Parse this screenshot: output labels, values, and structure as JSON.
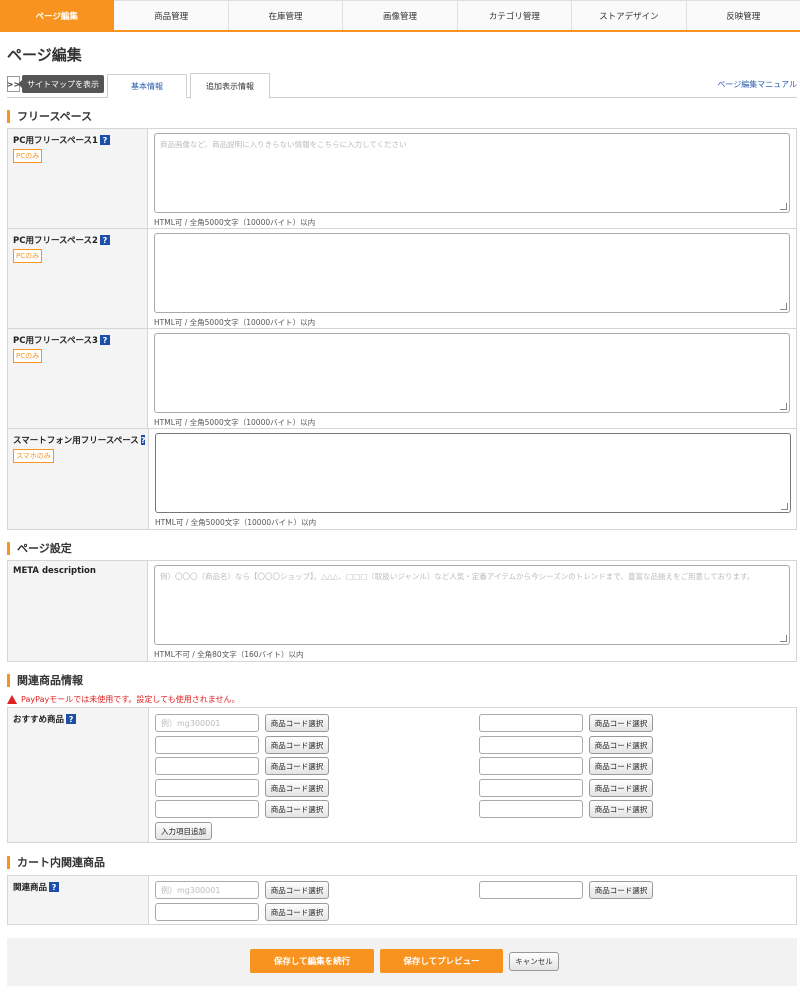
{
  "nav": {
    "tabs": [
      "ページ編集",
      "商品管理",
      "在庫管理",
      "画像管理",
      "カテゴリ管理",
      "ストアデザイン",
      "反映管理"
    ],
    "active_index": 0
  },
  "page_title": "ページ編集",
  "subtabs": {
    "sitemap_arrow": ">>",
    "sitemap_label": "サイトマップを表示",
    "basic_info": "基本情報",
    "extra_info": "追加表示情報",
    "manual_link": "ページ編集マニュアル"
  },
  "free_space": {
    "heading": "フリースペース",
    "rows": [
      {
        "label": "PC用フリースペース1",
        "badge": "PCのみ",
        "placeholder": "商品画像など、商品説明に入りきらない情報をこちらに入力してください",
        "hint": "HTML可 / 全角5000文字（10000バイト）以内"
      },
      {
        "label": "PC用フリースペース2",
        "badge": "PCのみ",
        "placeholder": "",
        "hint": "HTML可 / 全角5000文字（10000バイト）以内"
      },
      {
        "label": "PC用フリースペース3",
        "badge": "PCのみ",
        "placeholder": "",
        "hint": "HTML可 / 全角5000文字（10000バイト）以内"
      },
      {
        "label": "スマートフォン用フリースペース",
        "badge": "スマホのみ",
        "placeholder": "",
        "hint": "HTML可 / 全角5000文字（10000バイト）以内"
      }
    ]
  },
  "page_settings": {
    "heading": "ページ設定",
    "meta_label": "META description",
    "meta_placeholder": "例）〇〇〇（商品名）なら【〇〇〇ショップ】。△△△、□□□（取扱いジャンル）など人気・定番アイテムから今シーズンのトレンドまで、豊富な品揃えをご用意しております。",
    "meta_hint": "HTML不可 / 全角80文字（160バイト）以内"
  },
  "related": {
    "heading": "関連商品情報",
    "warning": "PayPayモールでは未使用です。設定しても使用されません。",
    "label": "おすすめ商品",
    "code_placeholder": "例）mg300001",
    "select_label": "商品コード選択",
    "add_label": "入力項目追加"
  },
  "cart": {
    "heading": "カート内関連商品",
    "label": "関連商品",
    "code_placeholder": "例）mg300001",
    "select_label": "商品コード選択"
  },
  "footer": {
    "save_continue": "保存して編集を続行",
    "save_preview": "保存してプレビュー",
    "cancel": "キャンセル"
  },
  "colors": {
    "accent": "#f7931e",
    "link": "#2a5db0",
    "help_icon": "#1d4fa8",
    "warning": "#e02020"
  }
}
